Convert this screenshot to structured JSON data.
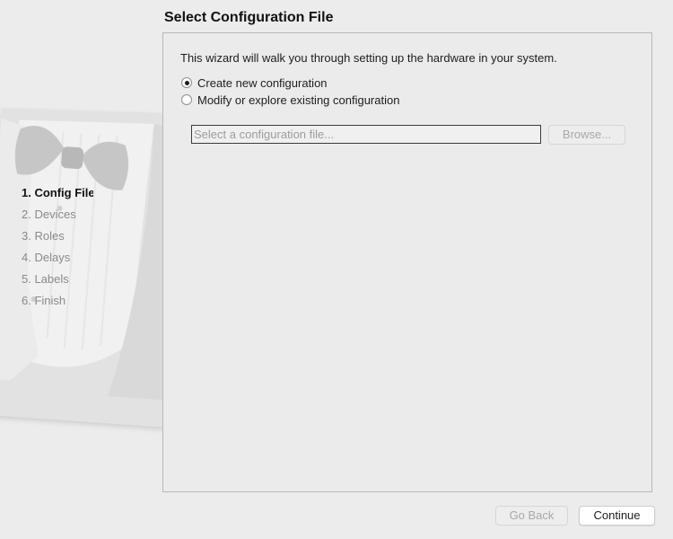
{
  "window": {
    "title": "Select Configuration File"
  },
  "sidebar": {
    "steps": [
      {
        "label": "1. Config File",
        "current": true
      },
      {
        "label": "2. Devices",
        "current": false
      },
      {
        "label": "3. Roles",
        "current": false
      },
      {
        "label": "4. Delays",
        "current": false
      },
      {
        "label": "5. Labels",
        "current": false
      },
      {
        "label": "6. Finish",
        "current": false
      }
    ],
    "art_icon": "butler-tuxedo-icon"
  },
  "main": {
    "intro_text": "This wizard will walk you through setting up the hardware in your system.",
    "options": [
      {
        "label": "Create new configuration",
        "selected": true
      },
      {
        "label": "Modify or explore existing configuration",
        "selected": false
      }
    ],
    "file_input": {
      "value": "",
      "placeholder": "Select a configuration file..."
    },
    "browse_label": "Browse..."
  },
  "footer": {
    "back_label": "Go Back",
    "continue_label": "Continue"
  },
  "colors": {
    "background": "#ececec",
    "border": "#b9b9b9",
    "disabled_text": "#a8a8a8"
  }
}
